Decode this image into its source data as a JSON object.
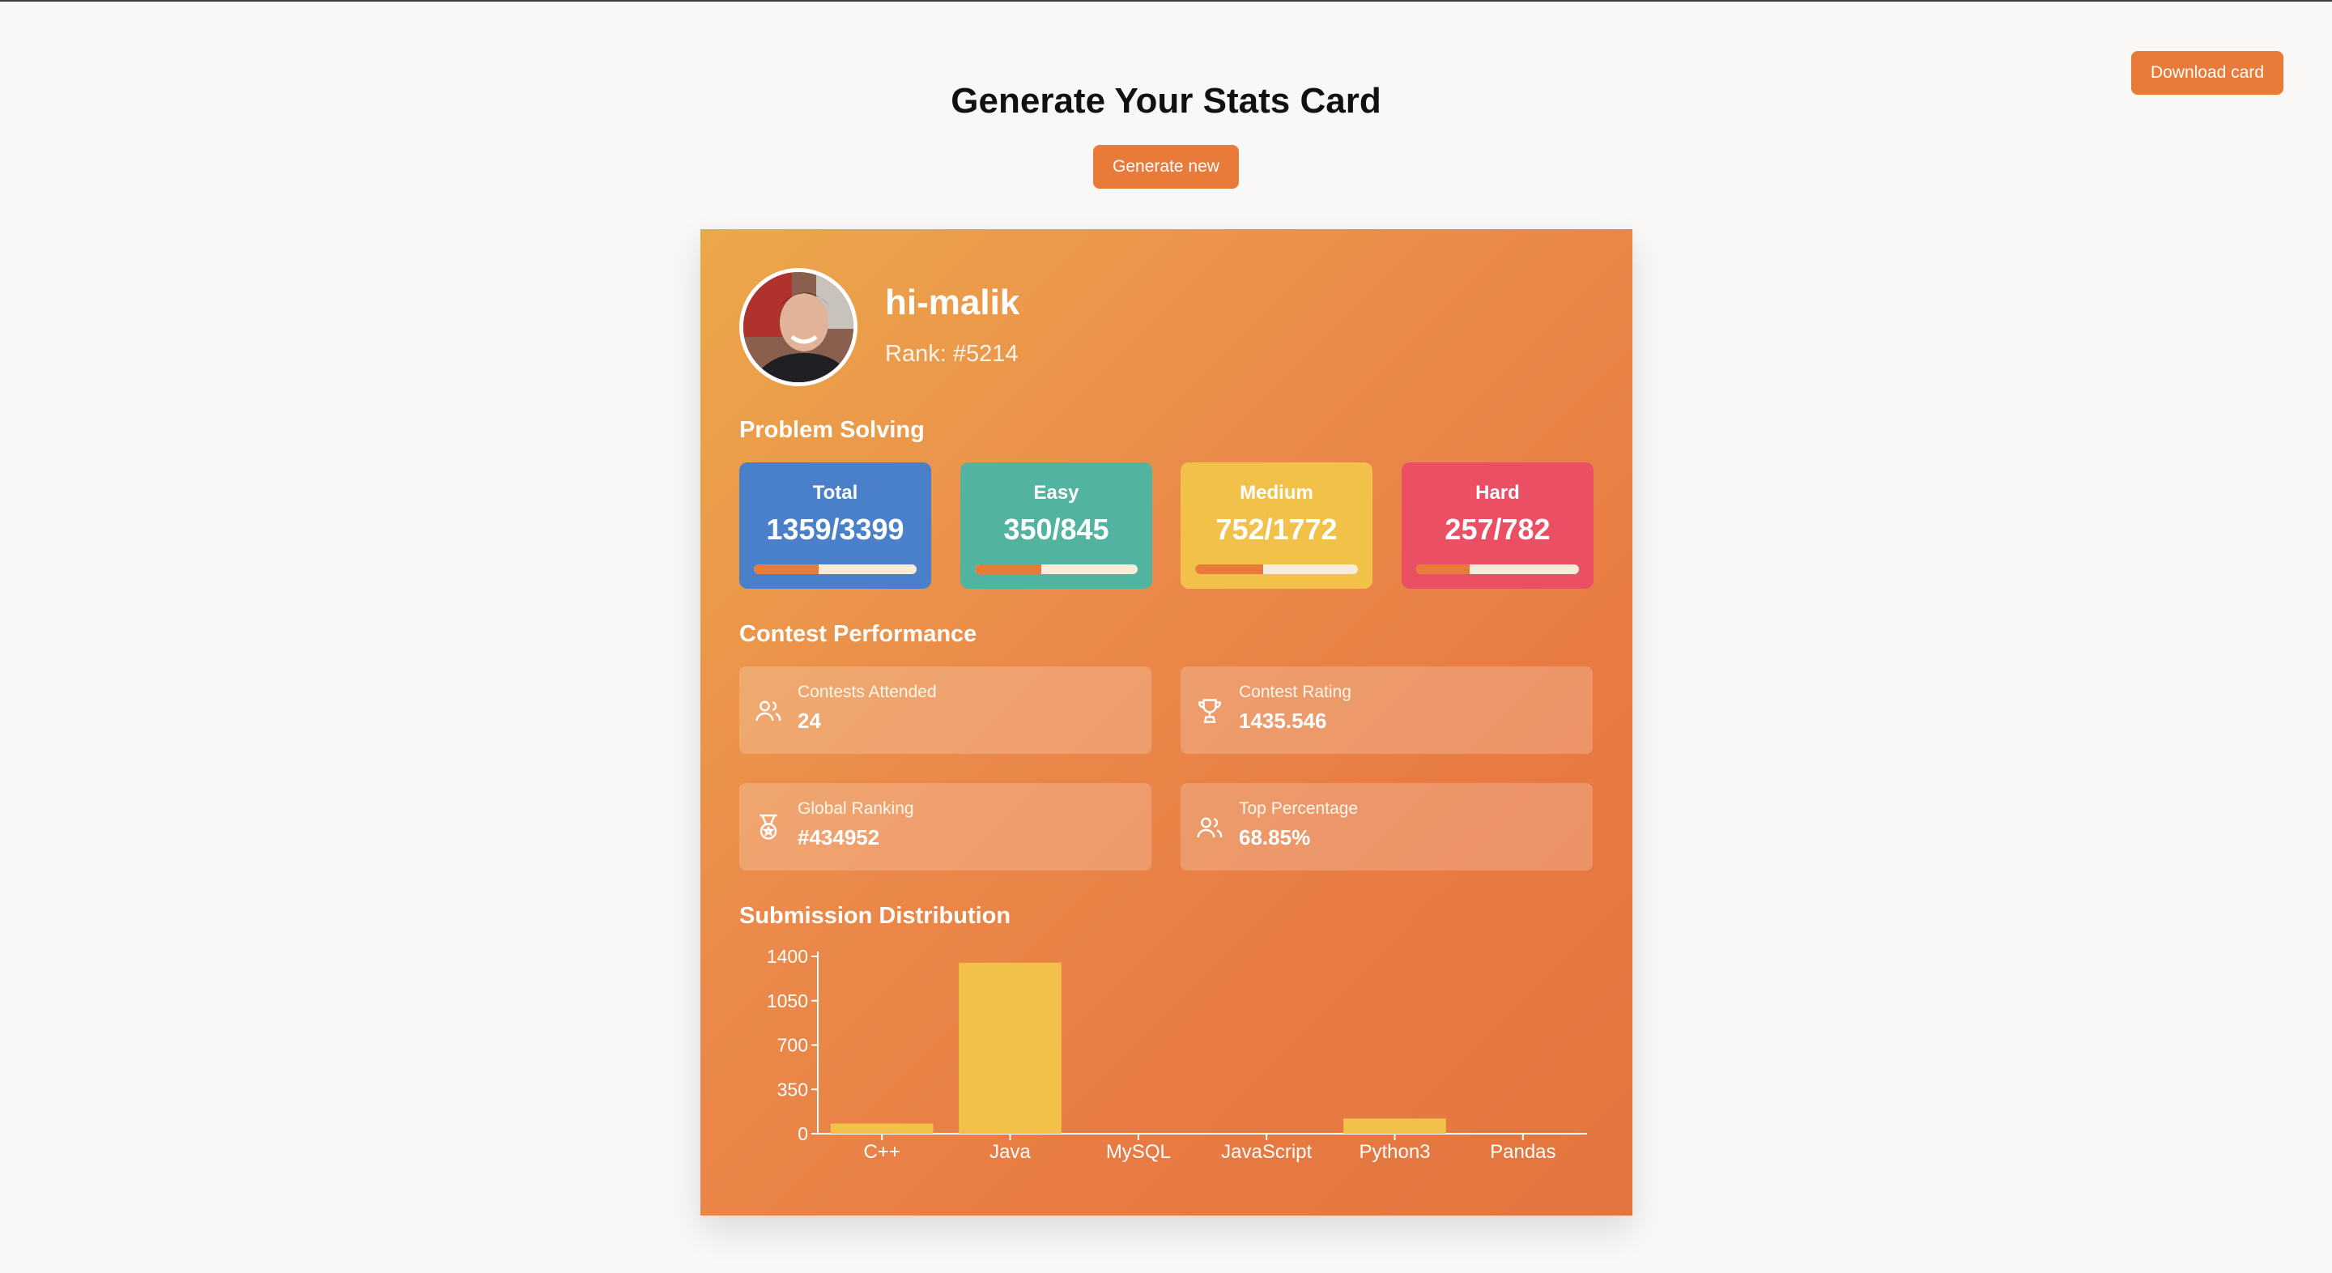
{
  "header": {
    "title": "Generate Your Stats Card",
    "download_label": "Download card",
    "generate_label": "Generate new"
  },
  "profile": {
    "username": "hi-malik",
    "rank": "Rank: #5214"
  },
  "problem_solving": {
    "title": "Problem Solving",
    "stats": [
      {
        "label": "Total",
        "value": "1359/3399",
        "progress": 0.4,
        "color": "#4a7fc9"
      },
      {
        "label": "Easy",
        "value": "350/845",
        "progress": 0.41,
        "color": "#52b4a0"
      },
      {
        "label": "Medium",
        "value": "752/1772",
        "progress": 0.42,
        "color": "#f2c14a"
      },
      {
        "label": "Hard",
        "value": "257/782",
        "progress": 0.33,
        "color": "#ea4f64"
      }
    ]
  },
  "contest": {
    "title": "Contest Performance",
    "items": [
      {
        "label": "Contests Attended",
        "value": "24",
        "icon": "users-icon"
      },
      {
        "label": "Contest Rating",
        "value": "1435.546",
        "icon": "trophy-icon"
      },
      {
        "label": "Global Ranking",
        "value": "#434952",
        "icon": "medal-icon"
      },
      {
        "label": "Top Percentage",
        "value": "68.85%",
        "icon": "users-icon"
      }
    ]
  },
  "submission": {
    "title": "Submission Distribution"
  },
  "chart_data": {
    "type": "bar",
    "categories": [
      "C++",
      "Java",
      "MySQL",
      "JavaScript",
      "Python3",
      "Pandas"
    ],
    "values": [
      80,
      1350,
      0,
      0,
      120,
      0
    ],
    "yticks": [
      0,
      350,
      700,
      1050,
      1400
    ],
    "ylim": [
      0,
      1400
    ],
    "title": "",
    "xlabel": "",
    "ylabel": "",
    "bar_color": "#f2c14a"
  }
}
